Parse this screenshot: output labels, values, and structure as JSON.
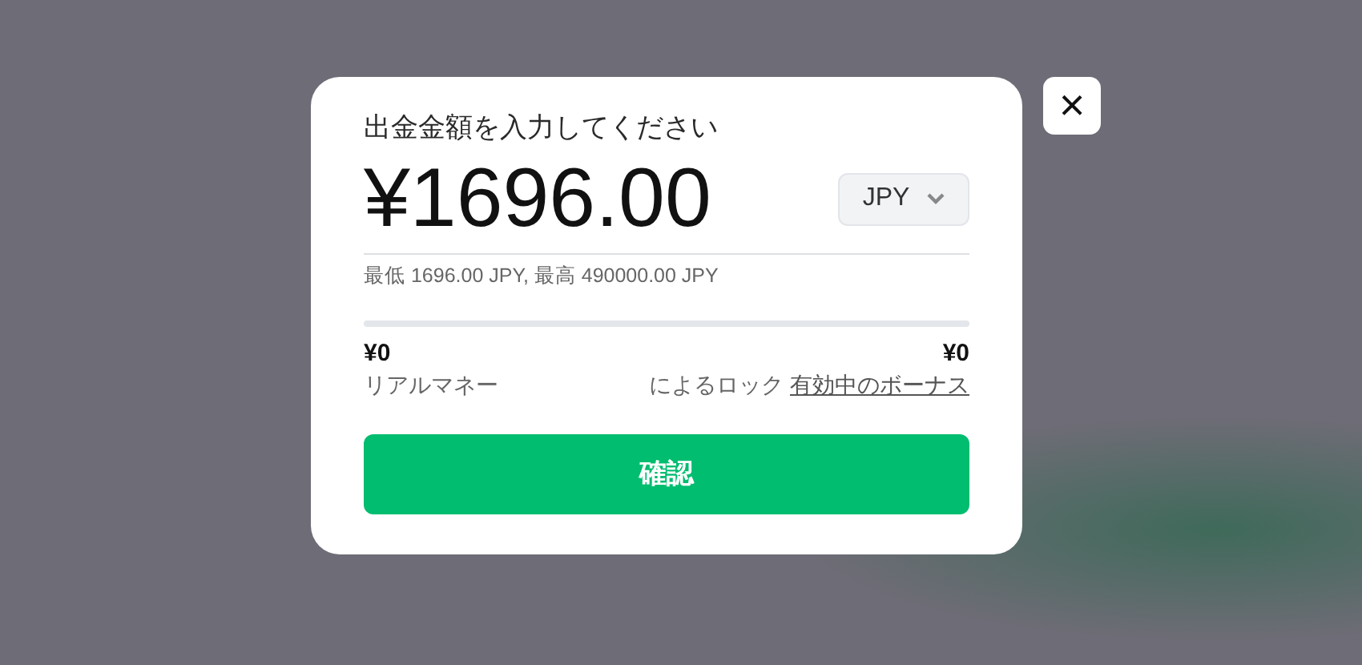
{
  "dialog": {
    "title": "出金金額を入力してください",
    "amount": "¥1696.00",
    "currency": "JPY",
    "limits": "最低 1696.00 JPY, 最高 490000.00 JPY",
    "balances": [
      {
        "value": "¥0",
        "label": "リアルマネー"
      },
      {
        "value": "¥0",
        "label": "によるロック",
        "link": "有効中のボーナス"
      }
    ],
    "confirm": "確認"
  },
  "close": "×"
}
